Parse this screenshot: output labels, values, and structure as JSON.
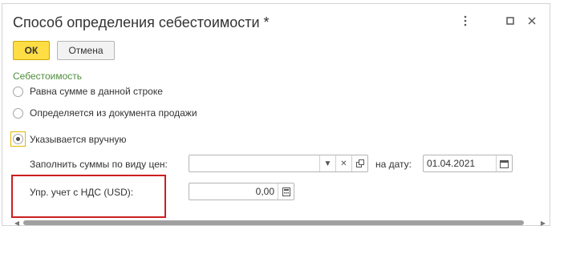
{
  "window": {
    "title": "Способ определения себестоимости *",
    "icons": [
      "more-icon",
      "maximize-icon",
      "close-icon"
    ]
  },
  "toolbar": {
    "ok_label": "ОК",
    "cancel_label": "Отмена"
  },
  "cost_group": {
    "label": "Себестоимость",
    "options": [
      {
        "label": "Равна сумме в данной строке",
        "checked": false
      },
      {
        "label": "Определяется из документа продажи",
        "checked": false
      },
      {
        "label": "Указывается вручную",
        "checked": true
      }
    ]
  },
  "fill_row": {
    "label": "Заполнить суммы по виду цен:",
    "price_type_value": "",
    "date_label": "на дату:",
    "date_value": "01.04.2021"
  },
  "amount_row": {
    "label": "Упр. учет с НДС (USD):",
    "value": "0,00"
  },
  "colors": {
    "ok_button": "#ffdd44",
    "group_label": "#4e8f3d",
    "highlight_border": "#cc1f1f"
  }
}
